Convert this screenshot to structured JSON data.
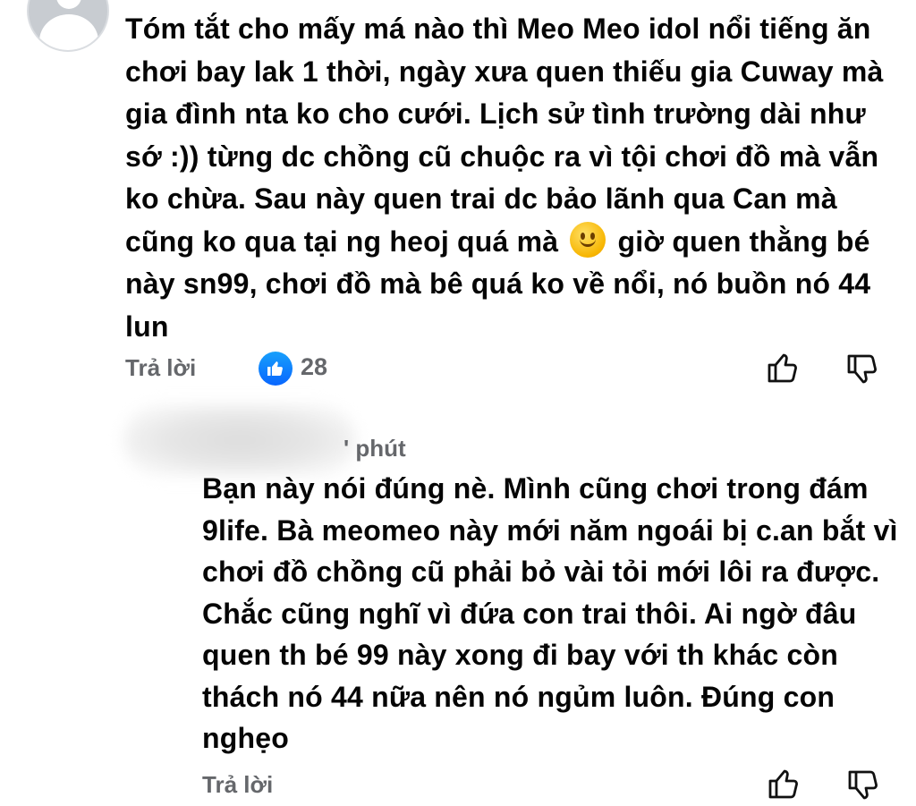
{
  "comment1": {
    "text_before_emoji": "Tóm tắt cho mấy má nào thì Meo Meo idol nổi tiếng ăn chơi bay lak 1 thời, ngày xưa quen thiếu gia Cuway mà gia đình nta ko cho cưới. Lịch sử tình trường dài như sớ :)) từng dc chồng cũ chuộc ra vì tội chơi đồ mà vẫn ko chừa. Sau này quen trai dc bảo lãnh qua Can mà cũng ko qua tại ng heoj quá mà ",
    "text_after_emoji": " giờ quen thằng bé này sn99, chơi đồ mà bê quá ko về nổi, nó buồn nó 44 lun",
    "emoji": "slightly-smiling-face",
    "reply_label": "Trả lời",
    "like_count": "28"
  },
  "comment2": {
    "time": "' phút",
    "text": "Bạn này nói đúng nè. Mình cũng chơi trong đám 9life. Bà meomeo này mới năm ngoái bị c.an bắt vì chơi đồ chồng cũ phải bỏ vài tỏi mới lôi ra được. Chắc cũng nghĩ vì đứa con trai thôi. Ai ngờ đâu quen th bé 99 này xong đi bay với th khác còn thách nó 44 nữa nên nó ngủm luôn. Đúng con nghẹo",
    "reply_label": "Trả lời"
  },
  "colors": {
    "text": "#050505",
    "meta": "#65676b",
    "like_blue": "#0866ff"
  }
}
